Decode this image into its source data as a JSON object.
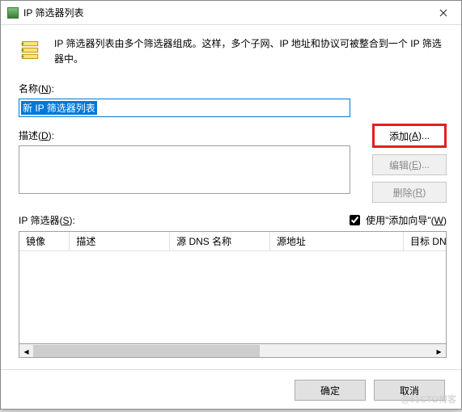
{
  "titlebar": {
    "title": "IP 筛选器列表"
  },
  "intro": {
    "text": "IP 筛选器列表由多个筛选器组成。这样，多个子网、IP 地址和协议可被整合到一个 IP 筛选器中。"
  },
  "name": {
    "label_prefix": "名称(",
    "label_hotkey": "N",
    "label_suffix": "):",
    "value": "新 IP 筛选器列表"
  },
  "desc": {
    "label_prefix": "描述(",
    "label_hotkey": "D",
    "label_suffix": "):",
    "value": ""
  },
  "buttons": {
    "add_prefix": "添加(",
    "add_hotkey": "A",
    "add_suffix": ")...",
    "edit_prefix": "编辑(",
    "edit_hotkey": "E",
    "edit_suffix": ")...",
    "remove_prefix": "删除(",
    "remove_hotkey": "R",
    "remove_suffix": ")"
  },
  "filterlist": {
    "label_prefix": "IP 筛选器(",
    "label_hotkey": "S",
    "label_suffix": "):",
    "wizard_prefix": "使用\"添加向导\"(",
    "wizard_suffix": ")",
    "wizard_hotkey": "W",
    "wizard_checked": true
  },
  "columns": {
    "c0": "镜像",
    "c1": "描述",
    "c2": "源 DNS 名称",
    "c3": "源地址",
    "c4": "目标 DNS 名称"
  },
  "footer": {
    "ok": "确定",
    "cancel": "取消"
  },
  "watermark": "@51CTO博客"
}
